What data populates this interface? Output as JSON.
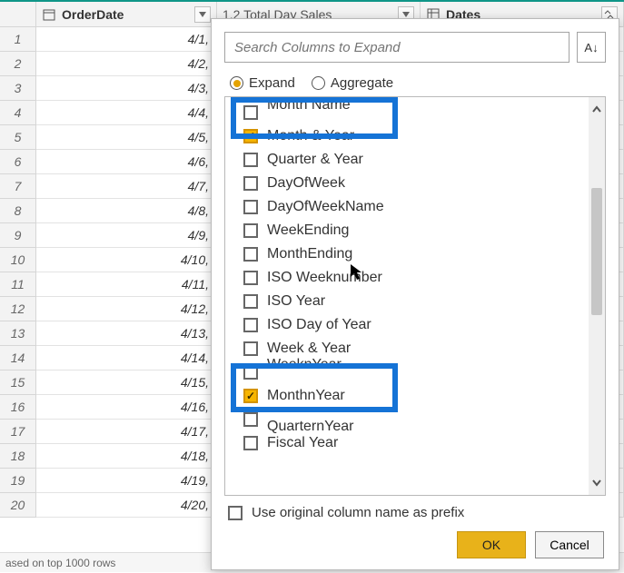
{
  "columns": {
    "c1": {
      "label": "OrderDate",
      "type_icon": "calendar"
    },
    "c2": {
      "label": "1.2  Total Day Sales",
      "type_icon": "numeric"
    },
    "c3": {
      "label": "Dates",
      "type_icon": "table"
    }
  },
  "rows": [
    {
      "idx": "1",
      "c1": "4/1,"
    },
    {
      "idx": "2",
      "c1": "4/2,"
    },
    {
      "idx": "3",
      "c1": "4/3,"
    },
    {
      "idx": "4",
      "c1": "4/4,"
    },
    {
      "idx": "5",
      "c1": "4/5,"
    },
    {
      "idx": "6",
      "c1": "4/6,"
    },
    {
      "idx": "7",
      "c1": "4/7,"
    },
    {
      "idx": "8",
      "c1": "4/8,"
    },
    {
      "idx": "9",
      "c1": "4/9,"
    },
    {
      "idx": "10",
      "c1": "4/10,"
    },
    {
      "idx": "11",
      "c1": "4/11,"
    },
    {
      "idx": "12",
      "c1": "4/12,"
    },
    {
      "idx": "13",
      "c1": "4/13,"
    },
    {
      "idx": "14",
      "c1": "4/14,"
    },
    {
      "idx": "15",
      "c1": "4/15,"
    },
    {
      "idx": "16",
      "c1": "4/16,"
    },
    {
      "idx": "17",
      "c1": "4/17,"
    },
    {
      "idx": "18",
      "c1": "4/18,"
    },
    {
      "idx": "19",
      "c1": "4/19,"
    },
    {
      "idx": "20",
      "c1": "4/20,"
    }
  ],
  "status_bar": "ased on top 1000 rows",
  "expand_panel": {
    "search_placeholder": "Search Columns to Expand",
    "radio": {
      "expand": "Expand",
      "aggregate": "Aggregate",
      "selected": "expand"
    },
    "items": [
      {
        "label": "Month Name",
        "checked": false,
        "cutoff": "top"
      },
      {
        "label": "Month & Year",
        "checked": true
      },
      {
        "label": "Quarter & Year",
        "checked": false
      },
      {
        "label": "DayOfWeek",
        "checked": false
      },
      {
        "label": "DayOfWeekName",
        "checked": false
      },
      {
        "label": "WeekEnding",
        "checked": false
      },
      {
        "label": "MonthEnding",
        "checked": false
      },
      {
        "label": "ISO Weeknumber",
        "checked": false
      },
      {
        "label": "ISO Year",
        "checked": false
      },
      {
        "label": "ISO Day of Year",
        "checked": false
      },
      {
        "label": "Week & Year",
        "checked": false
      },
      {
        "label": "WeeknYear",
        "checked": false,
        "cutoff": "top"
      },
      {
        "label": "MonthnYear",
        "checked": true
      },
      {
        "label": "QuarternYear",
        "checked": false,
        "cutoff": "bot"
      },
      {
        "label": "Fiscal Year",
        "checked": false
      }
    ],
    "prefix_label": "Use original column name as prefix",
    "prefix_checked": false,
    "ok_label": "OK",
    "cancel_label": "Cancel"
  }
}
